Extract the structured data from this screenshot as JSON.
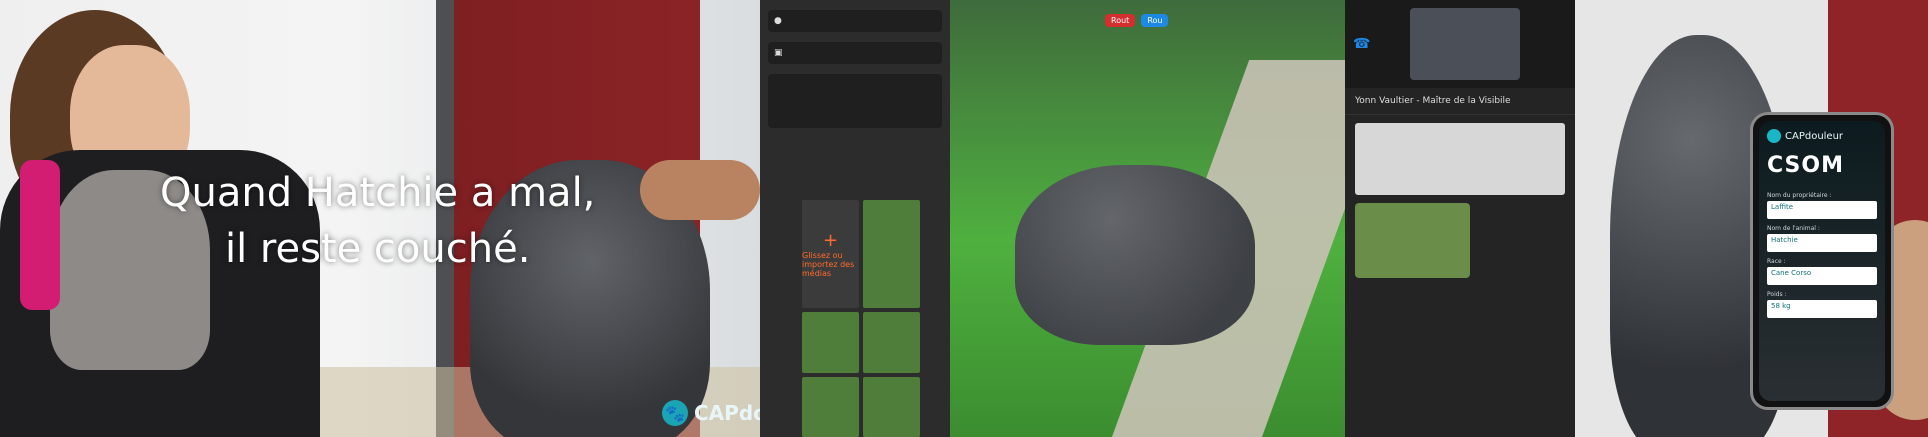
{
  "caption": {
    "line1": "Quand Hatchie a mal,",
    "line2": "il reste couché."
  },
  "branding": {
    "logo_text": "CAPdou"
  },
  "app_ui": {
    "video_buttons": [
      "Rout",
      "Rou"
    ],
    "chat_header": "Yonn Vaultier - Maître de la Visibile",
    "add_tile_label": "Glissez ou importez des médias"
  },
  "phone": {
    "app_title": "CAPdouleur",
    "brand": "CSOM",
    "fields": [
      {
        "label": "Nom du propriétaire :",
        "value": "Laffite"
      },
      {
        "label": "Nom de l'animal :",
        "value": "Hatchie"
      },
      {
        "label": "Race :",
        "value": "Cane Corso"
      },
      {
        "label": "Poids :",
        "value": "58 kg"
      }
    ]
  }
}
